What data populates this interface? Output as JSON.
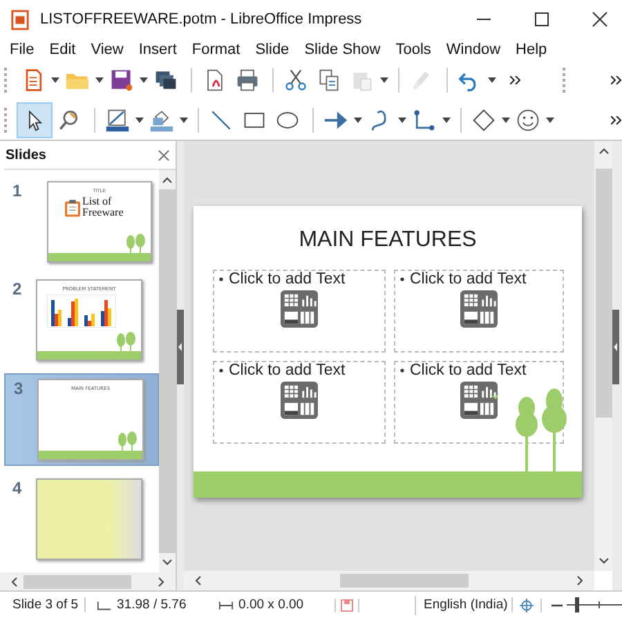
{
  "window": {
    "title": "LISTOFFREEWARE.potm - LibreOffice Impress"
  },
  "menu": [
    "File",
    "Edit",
    "View",
    "Insert",
    "Format",
    "Slide",
    "Slide Show",
    "Tools",
    "Window",
    "Help"
  ],
  "standard_toolbar": [
    {
      "kind": "new",
      "dropdown": true,
      "disabled": false
    },
    {
      "kind": "open",
      "dropdown": true,
      "disabled": false
    },
    {
      "kind": "save",
      "dropdown": true,
      "disabled": false
    },
    {
      "kind": "templates",
      "dropdown": false,
      "disabled": false
    },
    {
      "kind": "sep"
    },
    {
      "kind": "pdf",
      "dropdown": false,
      "disabled": false
    },
    {
      "kind": "print",
      "dropdown": false,
      "disabled": false
    },
    {
      "kind": "sep"
    },
    {
      "kind": "cut",
      "dropdown": false,
      "disabled": false
    },
    {
      "kind": "copy",
      "dropdown": false,
      "disabled": false
    },
    {
      "kind": "paste",
      "dropdown": true,
      "disabled": true
    },
    {
      "kind": "sep"
    },
    {
      "kind": "clone",
      "dropdown": false,
      "disabled": true
    },
    {
      "kind": "sep"
    },
    {
      "kind": "undo",
      "dropdown": true,
      "disabled": false
    }
  ],
  "drawing_toolbar": [
    {
      "kind": "select",
      "dropdown": false,
      "selected": true
    },
    {
      "kind": "zoom",
      "dropdown": false,
      "selected": false
    },
    {
      "kind": "sep"
    },
    {
      "kind": "linecolor",
      "dropdown": true,
      "selected": false
    },
    {
      "kind": "fill",
      "dropdown": true,
      "selected": false
    },
    {
      "kind": "sep"
    },
    {
      "kind": "line",
      "dropdown": false,
      "selected": false
    },
    {
      "kind": "rect",
      "dropdown": false,
      "selected": false
    },
    {
      "kind": "ellipse",
      "dropdown": false,
      "selected": false
    },
    {
      "kind": "sep"
    },
    {
      "kind": "arrow",
      "dropdown": true,
      "selected": false
    },
    {
      "kind": "curve",
      "dropdown": true,
      "selected": false
    },
    {
      "kind": "connector",
      "dropdown": true,
      "selected": false
    },
    {
      "kind": "sep"
    },
    {
      "kind": "diamond",
      "dropdown": true,
      "selected": false
    },
    {
      "kind": "smiley",
      "dropdown": true,
      "selected": false
    }
  ],
  "slides_panel": {
    "title": "Slides",
    "slides": [
      {
        "number": "1",
        "selected": false,
        "kind": "title",
        "texts": [
          "TITLE",
          "List of",
          "Freeware"
        ]
      },
      {
        "number": "2",
        "selected": false,
        "kind": "chart",
        "texts": [
          "PROBLEM STATEMENT"
        ]
      },
      {
        "number": "3",
        "selected": true,
        "kind": "content",
        "texts": [
          "MAIN FEATURES"
        ]
      },
      {
        "number": "4",
        "selected": false,
        "kind": "blank"
      }
    ]
  },
  "slide": {
    "title": "MAIN FEATURES",
    "placeholders": [
      "Click to add Text",
      "Click to add Text",
      "Click to add Text",
      "Click to add Text"
    ]
  },
  "status_bar": {
    "slide": "Slide 3 of 5",
    "position": "31.98 / 5.76",
    "size": "0.00 x 0.00",
    "language": "English (India)",
    "zoom": {
      "level": 0.15
    }
  }
}
